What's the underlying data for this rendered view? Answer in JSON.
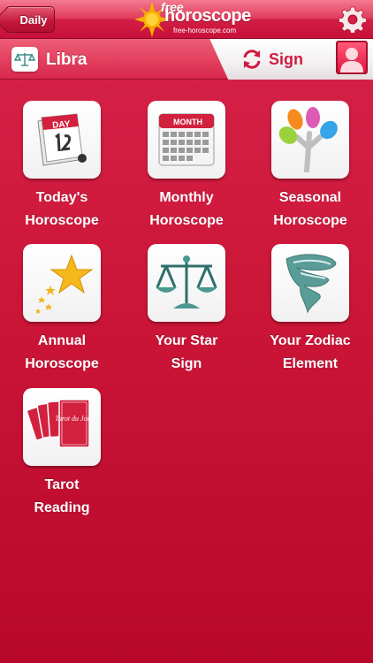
{
  "topbar": {
    "back_label": "Daily",
    "logo_free": "free",
    "logo_word": "horoscope",
    "logo_url": "free-horoscope.com"
  },
  "subbar": {
    "sign_name": "Libra",
    "sign_button_label": "Sign"
  },
  "tiles": [
    {
      "label": "Today's\nHoroscope",
      "icon": "day-calendar-icon",
      "icon_text": "DAY"
    },
    {
      "label": "Monthly\nHoroscope",
      "icon": "month-calendar-icon",
      "icon_text": "MONTH"
    },
    {
      "label": "Seasonal\nHoroscope",
      "icon": "seasonal-tree-icon"
    },
    {
      "label": "Annual\nHoroscope",
      "icon": "star-icon"
    },
    {
      "label": "Your Star\nSign",
      "icon": "libra-scales-icon"
    },
    {
      "label": "Your Zodiac\nElement",
      "icon": "whirlwind-icon"
    },
    {
      "label": "Tarot\nReading",
      "icon": "tarot-cards-icon",
      "icon_text": "Tarot du Jour"
    }
  ],
  "colors": {
    "background": "#cc1638",
    "accent": "#d01a42",
    "tile_bg": "#ffffff"
  }
}
